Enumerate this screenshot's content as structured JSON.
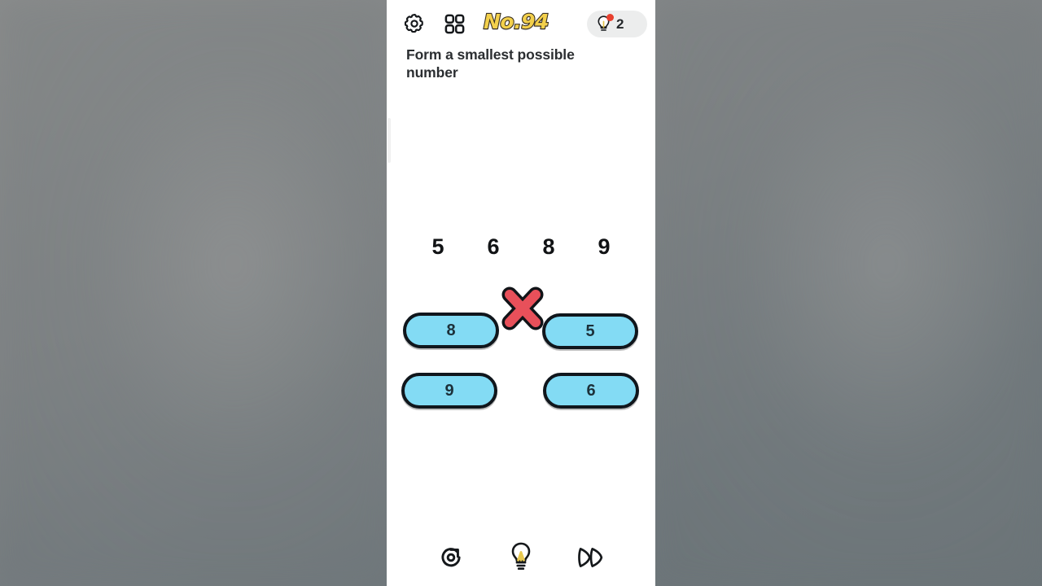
{
  "app": {
    "level_title": "No.94",
    "question": "Form a smallest possible number"
  },
  "topbar": {
    "settings_icon": "gear-icon",
    "levels_icon": "grid-levels-icon",
    "hint": {
      "icon": "lightbulb-icon",
      "count": "2",
      "has_notification_dot": true
    }
  },
  "puzzle": {
    "target_digits": [
      "5",
      "6",
      "8",
      "9"
    ],
    "tiles": [
      {
        "label": "8",
        "row": 1,
        "col": 1
      },
      {
        "label": "5",
        "row": 1,
        "col": 2
      },
      {
        "label": "9",
        "row": 2,
        "col": 1
      },
      {
        "label": "6",
        "row": 2,
        "col": 2
      }
    ],
    "overlay_marker": "red-x-icon"
  },
  "bottombar": {
    "items": [
      {
        "name": "restart-icon",
        "label": "restart"
      },
      {
        "name": "hint-bulb-icon",
        "label": "hint"
      },
      {
        "name": "skip-icon",
        "label": "skip"
      }
    ]
  },
  "colors": {
    "tile_fill": "#83dbf4",
    "tile_stroke": "#10161c",
    "level_title": "#f3d04b",
    "accent_red": "#e8402e",
    "panel_bg": "#ffffff",
    "backdrop": "#7f8385"
  }
}
